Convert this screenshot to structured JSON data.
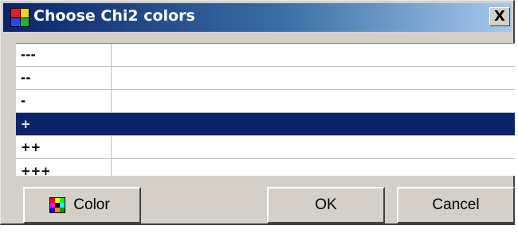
{
  "window": {
    "title": "Choose Chi2 colors",
    "close_glyph": "X",
    "icon": "app-window-icon"
  },
  "grid": {
    "rows": [
      {
        "label": "---",
        "selected": false
      },
      {
        "label": "--",
        "selected": false
      },
      {
        "label": "-",
        "selected": false
      },
      {
        "label": "+",
        "selected": true
      },
      {
        "label": "++",
        "selected": false
      },
      {
        "label": "+++",
        "selected": false
      }
    ]
  },
  "buttons": {
    "color_label": "Color",
    "color_icon": "palette-icon",
    "ok_label": "OK",
    "cancel_label": "Cancel"
  },
  "colors": {
    "title_gradient_start": "#0a246a",
    "title_gradient_end": "#a6caf0",
    "selection": "#0a246a",
    "face": "#d4d0c8"
  }
}
